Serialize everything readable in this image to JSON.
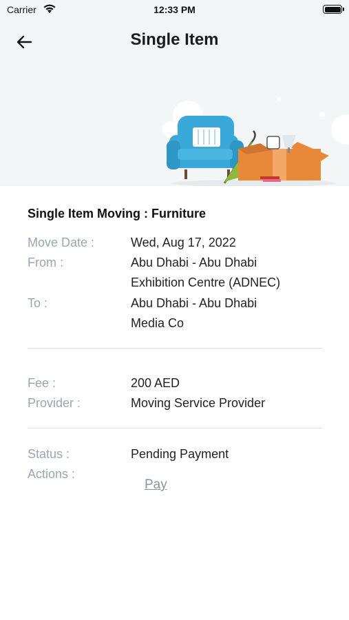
{
  "status_bar": {
    "carrier": "Carrier",
    "time": "12:33 PM"
  },
  "header": {
    "title": "Single Item",
    "back_icon": "arrow-left-icon"
  },
  "item": {
    "title": "Single Item Moving : Furniture",
    "move_date_label": "Move Date :",
    "move_date": "Wed, Aug 17, 2022",
    "from_label": "From :",
    "from_line1": "Abu Dhabi - Abu Dhabi",
    "from_line2": "Exhibition Centre (ADNEC)",
    "to_label": "To :",
    "to_line1": "Abu Dhabi - Abu Dhabi",
    "to_line2": "Media Co",
    "fee_label": "Fee :",
    "fee": "200 AED",
    "provider_label": "Provider :",
    "provider": "Moving Service Provider",
    "status_label": "Status :",
    "status": "Pending Payment",
    "actions_label": "Actions :",
    "pay_label": "Pay"
  },
  "colors": {
    "background": "#f3f6f7",
    "label": "#9aa5b4",
    "link": "#8a95a3",
    "sofa": "#3aa8d8",
    "box": "#e8893a"
  }
}
